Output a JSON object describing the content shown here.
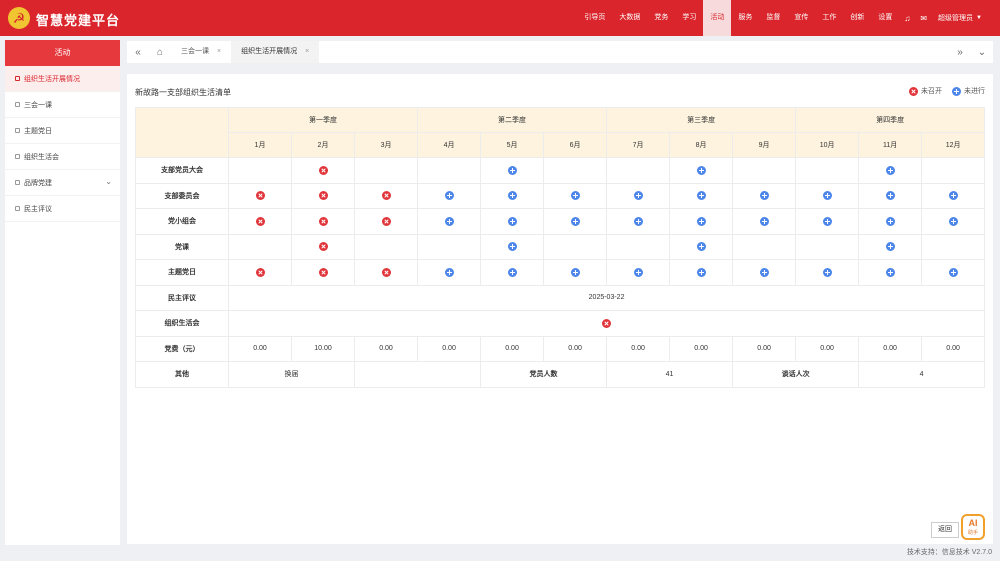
{
  "app": {
    "title": "智慧党建平台"
  },
  "topnav": {
    "items": [
      "引导页",
      "大数据",
      "党务",
      "学习",
      "活动",
      "服务",
      "监督",
      "宣传",
      "工作",
      "创新",
      "设置"
    ],
    "active_index": 4,
    "user": "超级管理员"
  },
  "sidebar": {
    "title": "活动",
    "items": [
      {
        "label": "组织生活开展情况",
        "active": true
      },
      {
        "label": "三会一课"
      },
      {
        "label": "主题党日"
      },
      {
        "label": "组织生活会"
      },
      {
        "label": "品牌党建",
        "has_children": true
      },
      {
        "label": "民主评议"
      }
    ]
  },
  "tabs": [
    {
      "label": "三会一课",
      "closable": true
    },
    {
      "label": "组织生活开展情况",
      "closable": true,
      "active": true
    }
  ],
  "main": {
    "title": "新故路一支部组织生活清单",
    "legend": {
      "not_held": "未召开",
      "pending": "未进行"
    },
    "quarters": [
      "第一季度",
      "第二季度",
      "第三季度",
      "第四季度"
    ],
    "months": [
      "1月",
      "2月",
      "3月",
      "4月",
      "5月",
      "6月",
      "7月",
      "8月",
      "9月",
      "10月",
      "11月",
      "12月"
    ],
    "rows": [
      {
        "label": "支部党员大会",
        "cells": [
          "",
          "R",
          "",
          "",
          "B",
          "",
          "",
          "B",
          "",
          "",
          "B",
          ""
        ]
      },
      {
        "label": "支部委员会",
        "cells": [
          "R",
          "R",
          "R",
          "B",
          "B",
          "B",
          "B",
          "B",
          "B",
          "B",
          "B",
          "B"
        ]
      },
      {
        "label": "党小组会",
        "cells": [
          "R",
          "R",
          "R",
          "B",
          "B",
          "B",
          "B",
          "B",
          "B",
          "B",
          "B",
          "B"
        ]
      },
      {
        "label": "党课",
        "cells": [
          "",
          "R",
          "",
          "",
          "B",
          "",
          "",
          "B",
          "",
          "",
          "B",
          ""
        ]
      },
      {
        "label": "主题党日",
        "cells": [
          "R",
          "R",
          "R",
          "B",
          "B",
          "B",
          "B",
          "B",
          "B",
          "B",
          "B",
          "B"
        ]
      }
    ],
    "democratic_review": {
      "label": "民主评议",
      "date": "2025-03-22"
    },
    "org_life": {
      "label": "组织生活会"
    },
    "fees": {
      "label": "党费（元）",
      "values": [
        "0.00",
        "10.00",
        "0.00",
        "0.00",
        "0.00",
        "0.00",
        "0.00",
        "0.00",
        "0.00",
        "0.00",
        "0.00",
        "0.00"
      ]
    },
    "other": {
      "label": "其他",
      "c1": "换届",
      "c2": "",
      "c3_label": "党员人数",
      "c3_value": "41",
      "c4_label": "谈话人次",
      "c4_value": "4"
    },
    "return_label": "返回",
    "ai_label": "AI",
    "ai_sub": "助手"
  },
  "footer": {
    "text": "技术支持：信息技术  V2.7.0"
  }
}
